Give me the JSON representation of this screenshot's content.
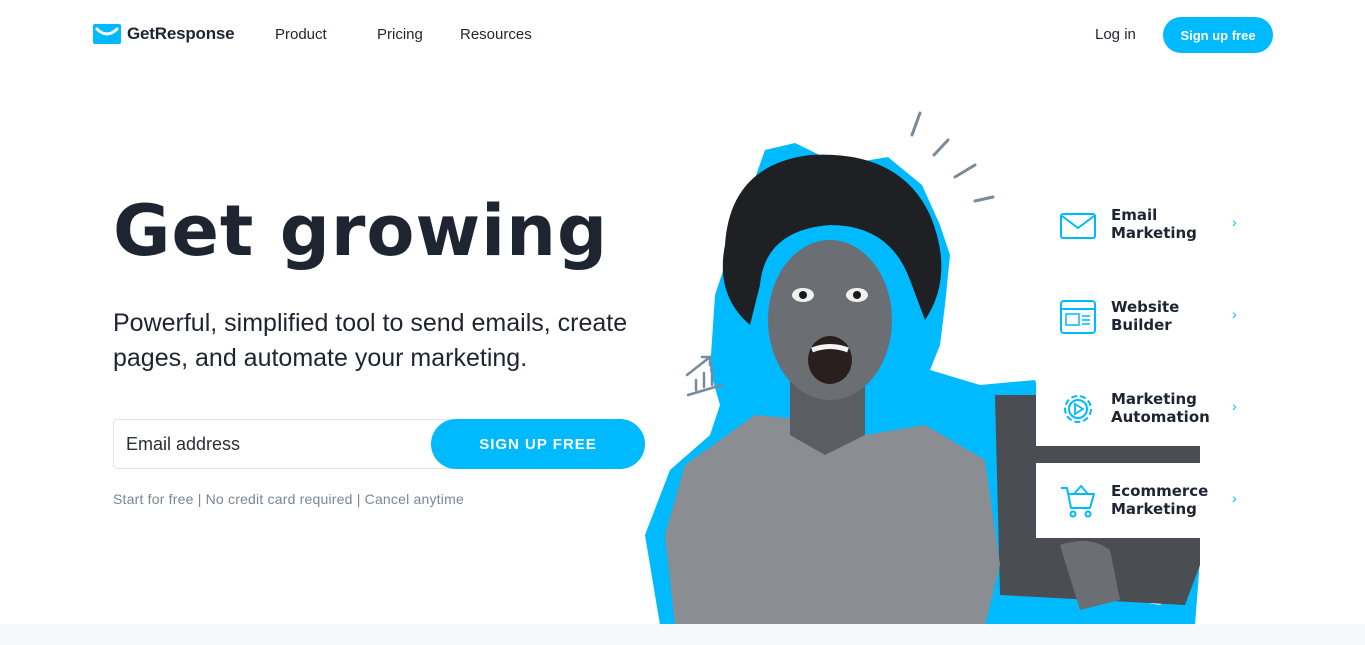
{
  "header": {
    "logo_text": "GetResponse",
    "nav": [
      {
        "label": "Product"
      },
      {
        "label": "Pricing"
      },
      {
        "label": "Resources"
      }
    ],
    "login_label": "Log in",
    "signup_label": "Sign up free"
  },
  "hero": {
    "title": "Get growing",
    "subtitle": "Powerful, simplified tool to send emails, create pages, and automate your marketing.",
    "email_placeholder": "Email address",
    "cta_label": "SIGN UP FREE",
    "fineprint": "Start for free | No credit card required | Cancel anytime"
  },
  "features": [
    {
      "label": "Email\nMarketing",
      "icon": "envelope-icon"
    },
    {
      "label": "Website\nBuilder",
      "icon": "browser-window-icon"
    },
    {
      "label": "Marketing\nAutomation",
      "icon": "gear-play-icon"
    },
    {
      "label": "Ecommerce\nMarketing",
      "icon": "shopping-cart-icon"
    }
  ],
  "colors": {
    "accent": "#00baff",
    "text": "#1f2530",
    "muted": "#7c8693"
  }
}
